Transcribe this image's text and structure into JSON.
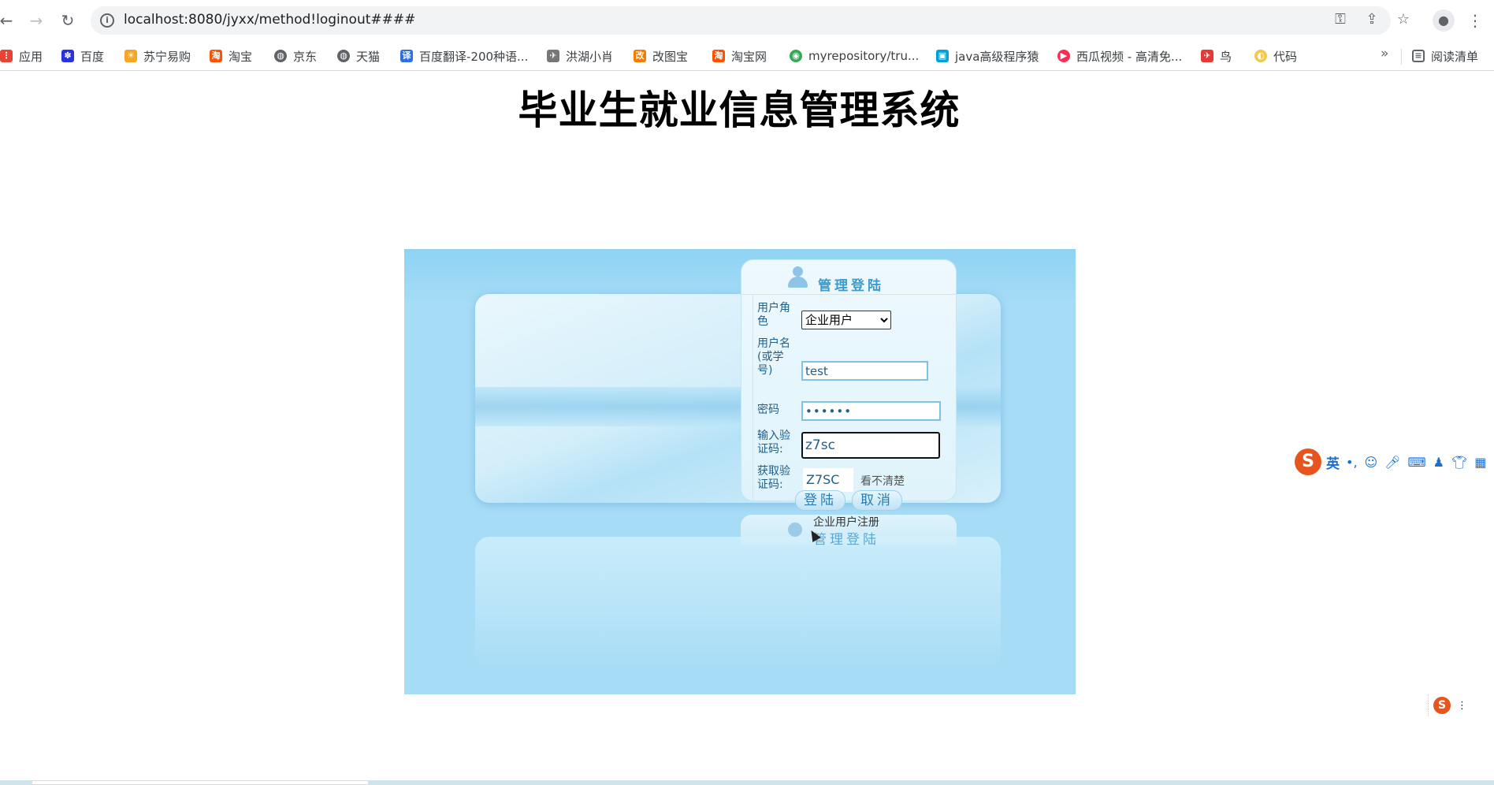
{
  "browser": {
    "url": "localhost:8080/jyxx/method!loginout####",
    "bookmarks": [
      {
        "label": "应用",
        "icon": "apps-grid-icon",
        "color": "#ea4335"
      },
      {
        "label": "百度",
        "icon": "baidu-paw-icon",
        "color": "#2932e1"
      },
      {
        "label": "苏宁易购",
        "icon": "suning-icon",
        "color": "#f5a623"
      },
      {
        "label": "淘宝",
        "icon": "taobao-icon",
        "color": "#ff5000"
      },
      {
        "label": "京东",
        "icon": "globe-icon",
        "color": "#5f6368"
      },
      {
        "label": "天猫",
        "icon": "globe-icon",
        "color": "#5f6368"
      },
      {
        "label": "百度翻译-200种语...",
        "icon": "translate-icon",
        "color": "#2f6fe4"
      },
      {
        "label": "洪湖小肖",
        "icon": "bird-icon",
        "color": "#777777"
      },
      {
        "label": "改图宝",
        "icon": "gaitubao-icon",
        "color": "#f57c00"
      },
      {
        "label": "淘宝网",
        "icon": "taobao-icon",
        "color": "#ff5000"
      },
      {
        "label": "myrepository/tru...",
        "icon": "chrome-icon",
        "color": "#34a853"
      },
      {
        "label": "java高级程序猿",
        "icon": "tv-icon",
        "color": "#00a1d6"
      },
      {
        "label": "西瓜视频 - 高清免...",
        "icon": "play-icon",
        "color": "#fe2c55"
      },
      {
        "label": "鸟",
        "icon": "bird-icon",
        "color": "#e53935"
      },
      {
        "label": "代码",
        "icon": "code-icon",
        "color": "#f2c94c"
      }
    ],
    "bookmarks_more": "»",
    "reading_list": "阅读清单"
  },
  "page": {
    "title": "毕业生就业信息管理系统"
  },
  "login": {
    "panel_title": "管理登陆",
    "role_label": "用户角色",
    "role_value": "企业用户",
    "username_label": "用户名(或学号)",
    "username_value": "test",
    "password_label": "密码",
    "password_value": "••••••",
    "code_label": "输入验证码:",
    "code_value": "z7sc",
    "fetch_code_label": "获取验证码:",
    "captcha_text": "Z7SC",
    "unclear_link": "看不清楚",
    "login_button": "登陆",
    "cancel_button": "取消",
    "register_link": "企业用户注册",
    "reflection_title": "管理登陆"
  },
  "ime": {
    "logo": "S",
    "mode": "英"
  }
}
